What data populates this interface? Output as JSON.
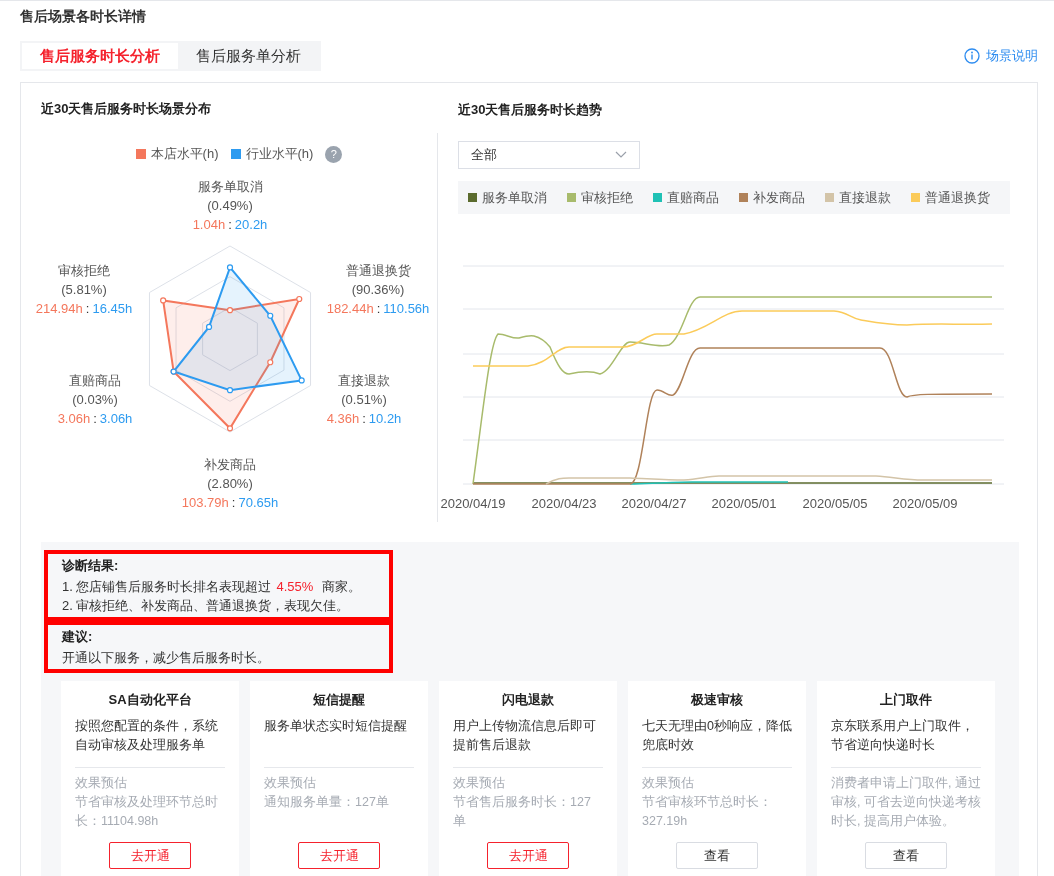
{
  "page_title": "售后场景各时长详情",
  "tabs": [
    {
      "label": "售后服务时长分析",
      "selected": true
    },
    {
      "label": "售后服务单分析",
      "selected": false
    }
  ],
  "help_link": "场景说明",
  "radar": {
    "title": "近30天售后服务时长场景分布",
    "legend": [
      {
        "label": "本店水平(h)",
        "color": "#f4775c"
      },
      {
        "label": "行业水平(h)",
        "color": "#2d9bf0"
      }
    ],
    "help_icon": "?",
    "axes": [
      {
        "name": "服务单取消",
        "share": "(0.49%)",
        "store": "1.04h",
        "separator": ":",
        "industry": "20.2h"
      },
      {
        "name": "审核拒绝",
        "share": "(5.81%)",
        "store": "214.94h",
        "separator": ":",
        "industry": "16.45h"
      },
      {
        "name": "普通退换货",
        "share": "(90.36%)",
        "store": "182.44h",
        "separator": ":",
        "industry": "110.56h"
      },
      {
        "name": "直赔商品",
        "share": "(0.03%)",
        "store": "3.06h",
        "separator": ":",
        "industry": "3.06h"
      },
      {
        "name": "直接退款",
        "share": "(0.51%)",
        "store": "4.36h",
        "separator": ":",
        "industry": "10.2h"
      },
      {
        "name": "补发商品",
        "share": "(2.80%)",
        "store": "103.79h",
        "separator": ":",
        "industry": "70.65h"
      }
    ]
  },
  "trend": {
    "title": "近30天售后服务时长趋势",
    "filter": {
      "value": "全部"
    },
    "legend": [
      {
        "label": "服务单取消",
        "color": "#5b6b2e"
      },
      {
        "label": "审核拒绝",
        "color": "#a8bb6c"
      },
      {
        "label": "直赔商品",
        "color": "#1fc1b5"
      },
      {
        "label": "补发商品",
        "color": "#b0825a"
      },
      {
        "label": "直接退款",
        "color": "#d3c4a8"
      },
      {
        "label": "普通退换货",
        "color": "#fbcb5a"
      }
    ],
    "dates": [
      "2020/04/19",
      "2020/04/23",
      "2020/04/27",
      "2020/05/01",
      "2020/05/05",
      "2020/05/09"
    ]
  },
  "diagnosis": {
    "title": "诊断结果:",
    "highlighted": true,
    "items": [
      {
        "text": "1. 您店铺售后服务时长排名表现超过",
        "highlight": "4.55%",
        "after": "商家。"
      },
      {
        "text": "2. 审核拒绝、补发商品、普通退换货，表现欠佳。"
      }
    ]
  },
  "suggestion": {
    "title": "建议:",
    "highlighted": true,
    "text": "开通以下服务，减少售后服务时长。"
  },
  "services": [
    {
      "title": "SA自动化平台",
      "desc": "按照您配置的条件，系统自动审核及处理服务单",
      "effect_label": "效果预估",
      "effect": "节省审核及处理环节总时长：11104.98h",
      "button": {
        "label": "去开通",
        "kind": "primary"
      }
    },
    {
      "title": "短信提醒",
      "desc": "服务单状态实时短信提醒",
      "effect_label": "效果预估",
      "effect": "通知服务单量：127单",
      "button": {
        "label": "去开通",
        "kind": "primary"
      }
    },
    {
      "title": "闪电退款",
      "desc": "用户上传物流信息后即可提前售后退款",
      "effect_label": "效果预估",
      "effect": "节省售后服务时长：127单",
      "button": {
        "label": "去开通",
        "kind": "primary"
      }
    },
    {
      "title": "极速审核",
      "desc": "七天无理由0秒响应，降低兜底时效",
      "effect_label": "效果预估",
      "effect": "节省审核环节总时长：327.19h",
      "button": {
        "label": "查看",
        "kind": "default"
      }
    },
    {
      "title": "上门取件",
      "desc": "京东联系用户上门取件，节省逆向快递时长",
      "effect": "消费者申请上门取件, 通过审核, 可省去逆向快递考核时长, 提高用户体验。",
      "button": {
        "label": "查看",
        "kind": "default"
      }
    }
  ]
}
